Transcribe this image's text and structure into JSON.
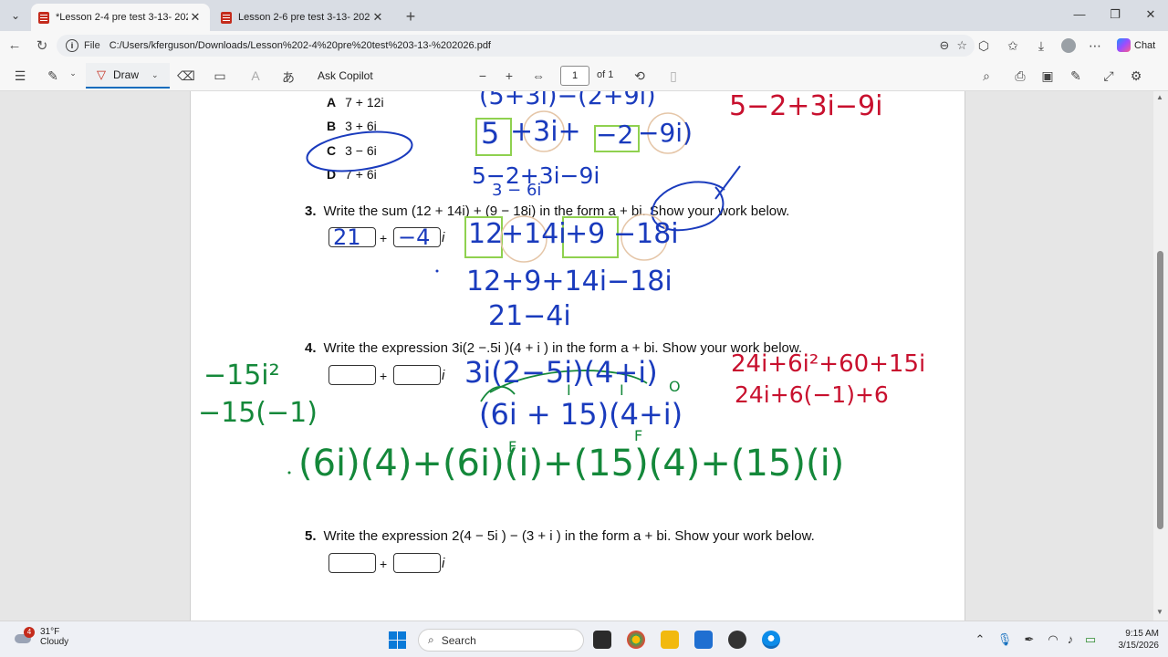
{
  "tabs": [
    {
      "title": "*Lesson 2-4 pre test 3-13- 2026.pdf",
      "active": true
    },
    {
      "title": "Lesson 2-6 pre test 3-13- 2026.pdf",
      "active": false
    }
  ],
  "address": {
    "file_label": "File",
    "url": "C:/Users/kferguson/Downloads/Lesson%202-4%20pre%20test%203-13-%202026.pdf"
  },
  "chat_label": "Chat",
  "pdf_toolbar": {
    "draw_label": "Draw",
    "ask_copilot": "Ask Copilot",
    "page_number": "1",
    "page_of": "of 1"
  },
  "document": {
    "options": [
      {
        "letter": "A",
        "text": "7 + 12i"
      },
      {
        "letter": "B",
        "text": "3 + 6i"
      },
      {
        "letter": "C",
        "text": "3 − 6i"
      },
      {
        "letter": "D",
        "text": "7 + 6i"
      }
    ],
    "q3": {
      "num": "3.",
      "text": "Write the sum (12 + 14i) + (9 − 18i) in the form a + bi. Show your work below."
    },
    "q4": {
      "num": "4.",
      "text": "Write the expression 3i(2 −.5i )(4 + i ) in the form a + bi. Show your work below."
    },
    "q5": {
      "num": "5.",
      "text": "Write the expression 2(4 − 5i ) − (3 + i ) in the form a + bi. Show your work below."
    },
    "plus": "+",
    "i": "i"
  },
  "ink": {
    "q2_top": "(5+3i)−(2+9i)",
    "q2_boxed_left": "5",
    "q2_line1_mid": "+3i+",
    "q2_boxed_right": "−2",
    "q2_line1_end": "−9i)",
    "q2_line2": "5−2+3i−9i",
    "q2_line3": "3 − 6i",
    "q2_red": "5−2+3i−9i",
    "q3_box1": "21",
    "q3_box2": "−4",
    "q3_boxed_a": "12",
    "q3_mid_a": "+14i",
    "q3_boxed_b": "+9",
    "q3_mid_b": "−18i",
    "q3_line2": "12+9+14i−18i",
    "q3_line3": "21−4i",
    "q4_blue1": "3i(2−5i)(4+i)",
    "q4_blue2": "(6i + 15)(4+i)",
    "q4_labels_f": "F",
    "q4_labels_i": "I",
    "q4_labels_o": "O",
    "q4_red1": "24i+6i²+60+15i",
    "q4_red2": "24i+6(−1)+6",
    "q4_green_left1": "−15i²",
    "q4_green_left2": "−15(−1)",
    "q4_green_main": "(6i)(4)+(6i)(i)+(15)(4)+(15)(i)"
  },
  "taskbar": {
    "weather_temp": "31°F",
    "weather_desc": "Cloudy",
    "weather_badge": "4",
    "search_label": "Search",
    "time": "9:15 AM",
    "date": "3/15/2026"
  },
  "colors": {
    "accent": "#0f6cbd",
    "ink_blue": "#1a3bbd",
    "ink_red": "#c8102e",
    "ink_green": "#14883a",
    "highlight_green": "#8fd14f"
  }
}
